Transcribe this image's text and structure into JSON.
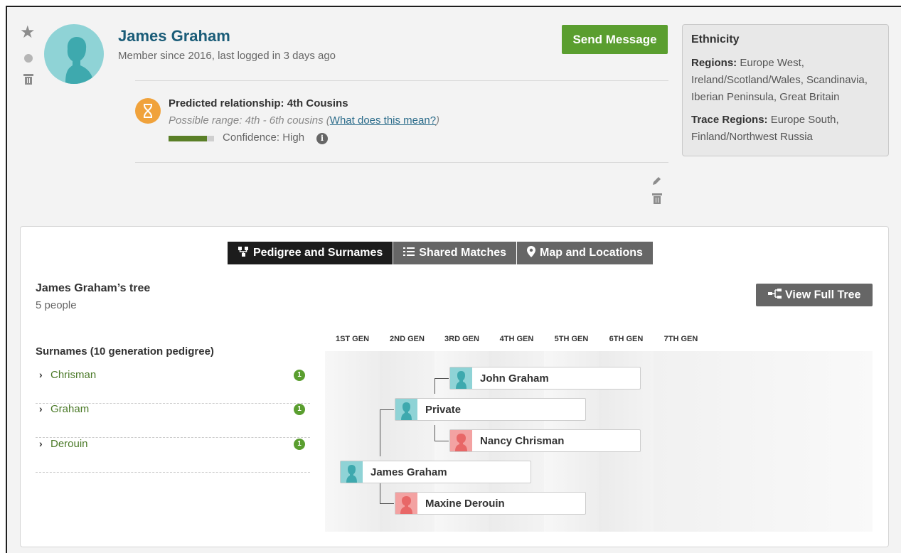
{
  "profile": {
    "name": "James Graham",
    "member_since": "Member since 2016, last logged in 3 days ago",
    "send_message": "Send Message"
  },
  "relationship": {
    "title": "Predicted relationship: 4th Cousins",
    "range_prefix": "Possible range: 4th - 6th cousins (",
    "range_link": "What does this mean?",
    "range_suffix": ")",
    "confidence": "Confidence: High",
    "confidence_level": 0.85
  },
  "ethnicity": {
    "title": "Ethnicity",
    "regions_label": "Regions:",
    "regions": "Europe West, Ireland/Scotland/Wales, Scandinavia, Iberian Peninsula, Great Britain",
    "trace_label": "Trace Regions:",
    "trace": "Europe South, Finland/Northwest Russia"
  },
  "tabs": [
    {
      "label": "Pedigree and Surnames",
      "icon": "pedigree-icon"
    },
    {
      "label": "Shared Matches",
      "icon": "list-icon"
    },
    {
      "label": "Map and Locations",
      "icon": "map-pin-icon"
    }
  ],
  "tree": {
    "title": "James Graham’s tree",
    "count": "5 people",
    "view_full": "View Full Tree",
    "surnames_title": "Surnames (10 generation pedigree)",
    "surnames": [
      {
        "name": "Chrisman",
        "count": "1"
      },
      {
        "name": "Graham",
        "count": "1"
      },
      {
        "name": "Derouin",
        "count": "1"
      }
    ],
    "generations": [
      "1ST GEN",
      "2ND GEN",
      "3RD GEN",
      "4TH GEN",
      "5TH GEN",
      "6TH GEN",
      "7TH GEN"
    ],
    "people": [
      {
        "name": "John Graham",
        "gender": "m"
      },
      {
        "name": "Private",
        "gender": "m"
      },
      {
        "name": "Nancy Chrisman",
        "gender": "f"
      },
      {
        "name": "James Graham",
        "gender": "m"
      },
      {
        "name": "Maxine Derouin",
        "gender": "f"
      }
    ]
  },
  "colors": {
    "accent_green": "#5a9e2f",
    "name_blue": "#1a5c78",
    "male": "#8fd3d6",
    "female": "#f3a2a2",
    "relationship_orange": "#f0a23b"
  }
}
